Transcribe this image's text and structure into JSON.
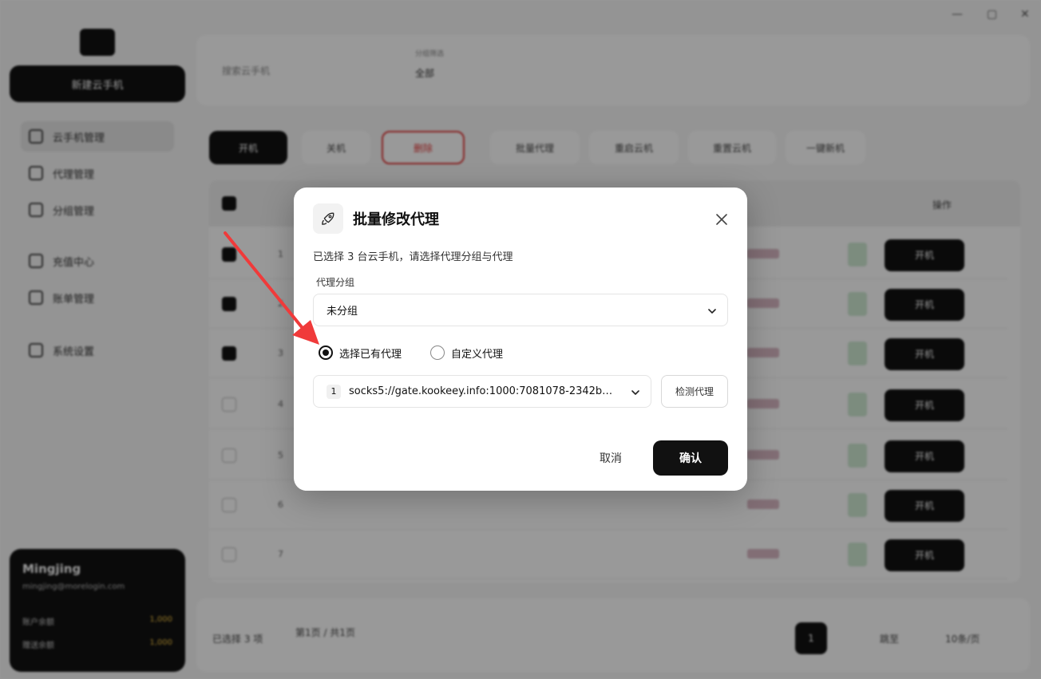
{
  "window": {
    "minimize": "—",
    "maximize": "▢",
    "close": "✕"
  },
  "sidebar": {
    "new_button": "新建云手机",
    "items": [
      {
        "label": "云手机管理",
        "icon": "home-icon"
      },
      {
        "label": "代理管理",
        "icon": "rocket-icon"
      },
      {
        "label": "分组管理",
        "icon": "folder-icon"
      },
      {
        "label": "充值中心",
        "icon": "wallet-icon"
      },
      {
        "label": "账单管理",
        "icon": "bill-icon"
      },
      {
        "label": "系统设置",
        "icon": "settings-icon"
      }
    ],
    "user": {
      "name": "Mingjing",
      "email": "mingjing@morelogin.com",
      "balance_label": "账户余额",
      "balance_value": "1,000",
      "credit_label": "赠送余额",
      "credit_value": "1,000"
    }
  },
  "topbar": {
    "search_placeholder": "搜索云手机",
    "group_label": "分组筛选",
    "group_value": "全部"
  },
  "toolbar": {
    "start": "开机",
    "stop": "关机",
    "delete": "删除",
    "proxy": "批量代理",
    "restart": "重启云机",
    "reset": "重置云机",
    "newdev": "一键新机"
  },
  "table": {
    "header_actions": "操作",
    "row_start": "开机",
    "rows": [
      {
        "idx": "1",
        "checked": true
      },
      {
        "idx": "2",
        "checked": true
      },
      {
        "idx": "3",
        "checked": true
      },
      {
        "idx": "4",
        "checked": false
      },
      {
        "idx": "5",
        "checked": false
      },
      {
        "idx": "6",
        "checked": false
      },
      {
        "idx": "7",
        "checked": false
      }
    ]
  },
  "footer": {
    "selected": "已选择 3 项",
    "page_info": "第1页 / 共1页",
    "page_current": "1",
    "per_page": "10条/页",
    "goto": "跳至"
  },
  "modal": {
    "icon": "rocket-icon",
    "title": "批量修改代理",
    "description": "已选择 3 台云手机，请选择代理分组与代理",
    "group_label": "代理分组",
    "group_value": "未分组",
    "radio_existing": "选择已有代理",
    "radio_custom": "自定义代理",
    "radio_selected": "existing",
    "proxy_index": "1",
    "proxy_value": "socks5://gate.kookeey.info:1000:7081078-2342b…",
    "check_button": "检测代理",
    "cancel_button": "取消",
    "confirm_button": "确认"
  },
  "colors": {
    "accent": "#111111",
    "danger": "#e23b3b",
    "annotation_arrow": "#f03a3a"
  }
}
